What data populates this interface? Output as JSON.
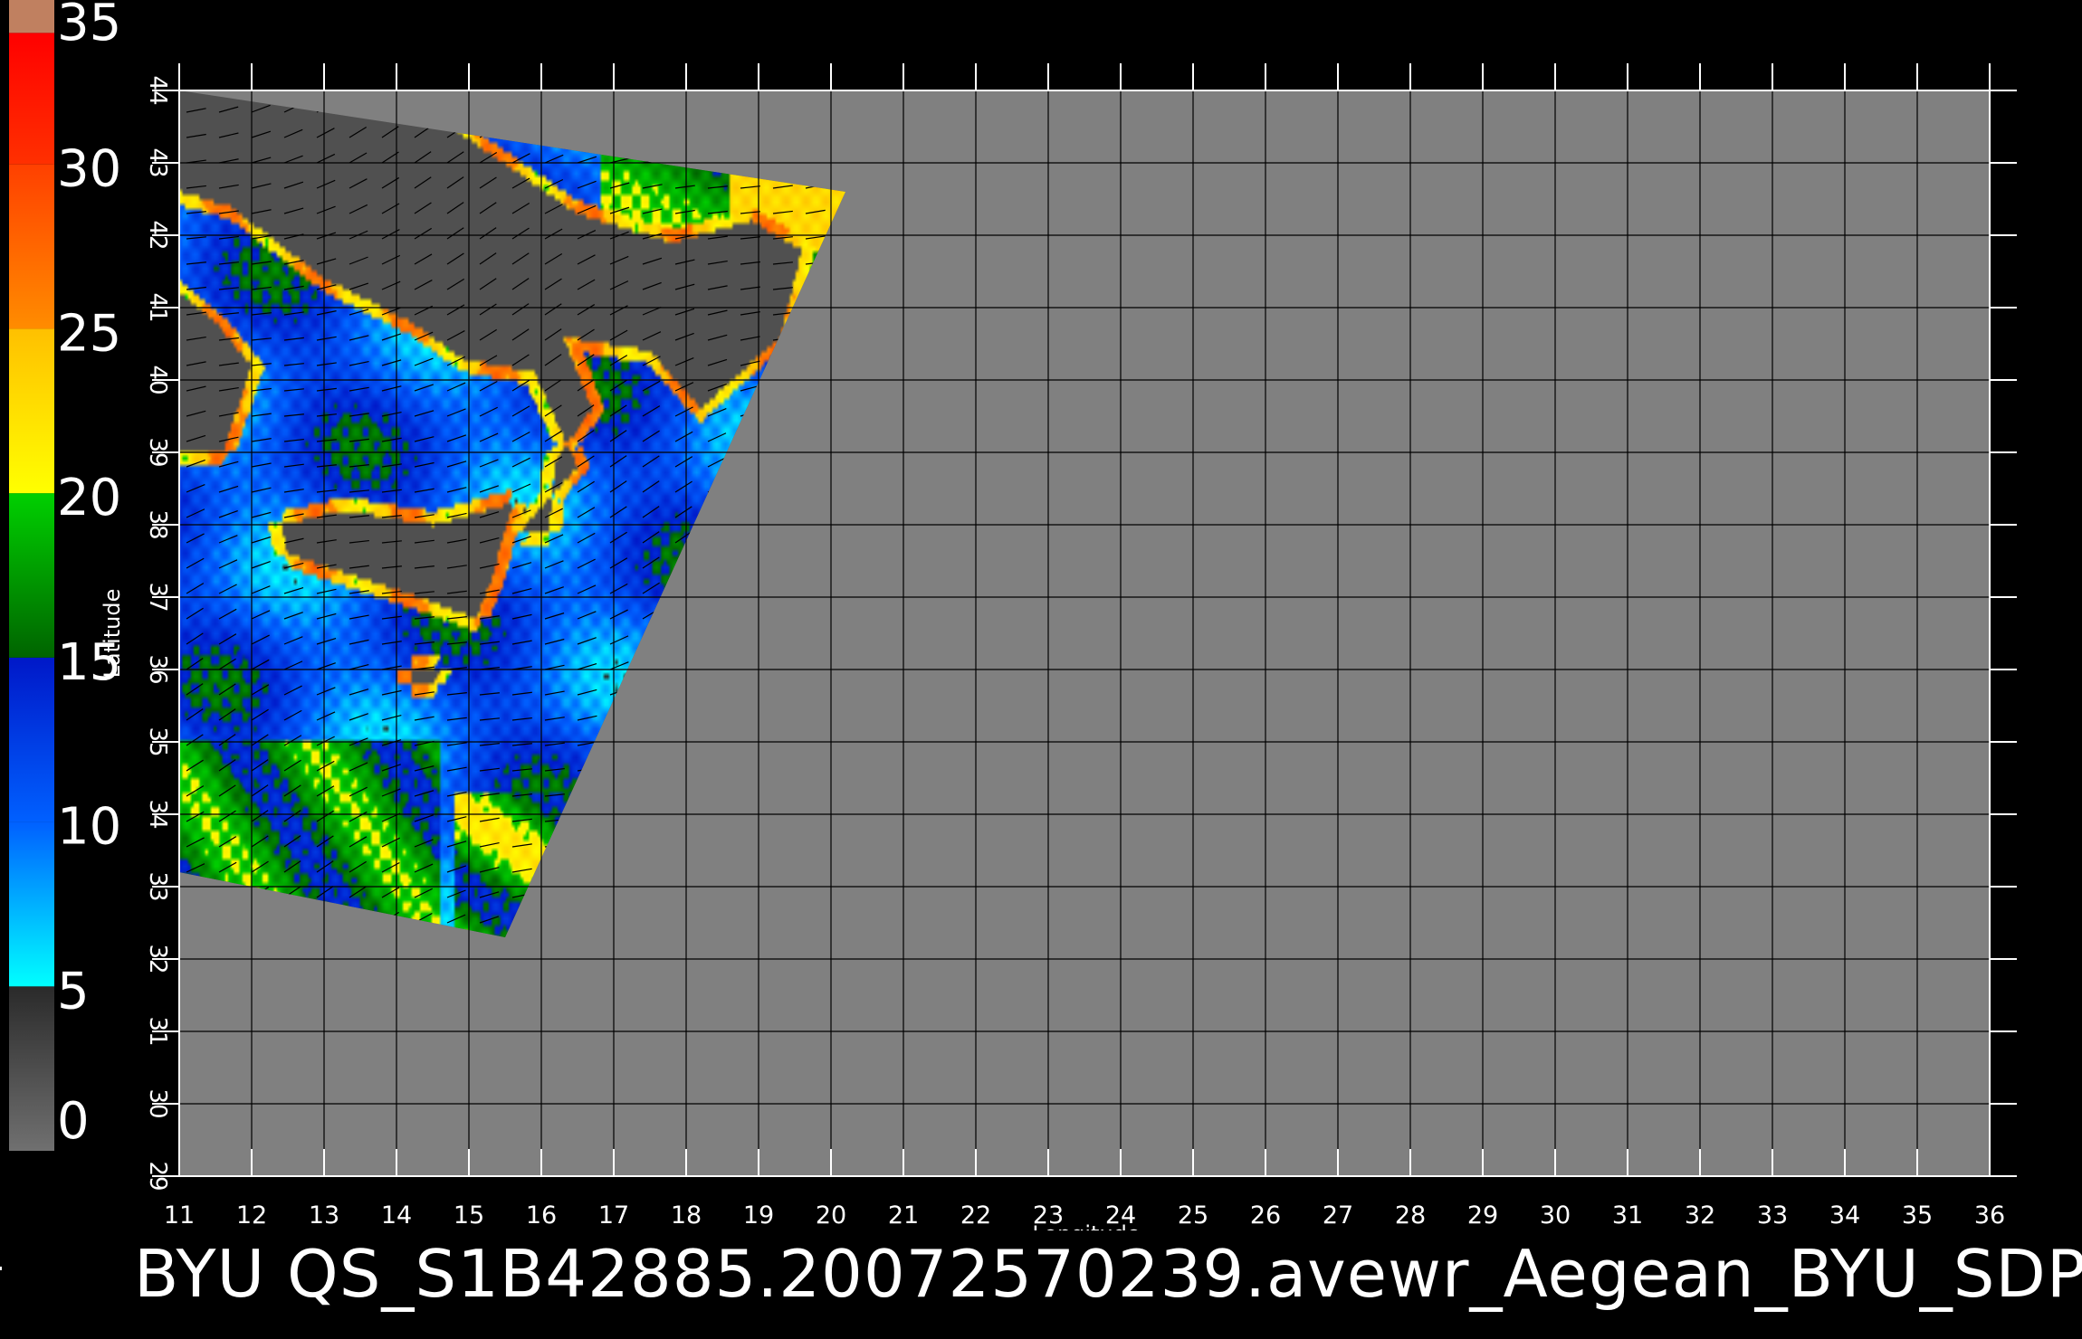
{
  "title": "BYU QS_S1B42885.20072570239.avewr_Aegean_BYU_SDP",
  "colorbar": {
    "labels": [
      "35",
      "30",
      "25",
      "20",
      "15",
      "10",
      "5",
      "0"
    ],
    "range": [
      0,
      35
    ],
    "segments": [
      {
        "from": 0,
        "to": 5,
        "colors": [
          "#707070",
          "#2a2a2a"
        ]
      },
      {
        "from": 5,
        "to": 10,
        "colors": [
          "#00ffff",
          "#0060ff"
        ]
      },
      {
        "from": 10,
        "to": 15,
        "colors": [
          "#0060ff",
          "#0018c8"
        ]
      },
      {
        "from": 15,
        "to": 20,
        "colors": [
          "#006400",
          "#00d000"
        ]
      },
      {
        "from": 20,
        "to": 25,
        "colors": [
          "#ffff00",
          "#ffc000"
        ]
      },
      {
        "from": 25,
        "to": 30,
        "colors": [
          "#ff8c00",
          "#ff4000"
        ]
      },
      {
        "from": 30,
        "to": 34,
        "colors": [
          "#ff3000",
          "#ff0000"
        ]
      },
      {
        "from": 34,
        "to": 35,
        "colors": [
          "#c08060",
          "#c08060"
        ]
      }
    ]
  },
  "map": {
    "xlabel": "Longitude",
    "ylabel": "Latitude",
    "lon_range": [
      11,
      36
    ],
    "lat_range": [
      29,
      44
    ],
    "lon_ticks": [
      "11",
      "12",
      "13",
      "14",
      "15",
      "16",
      "17",
      "18",
      "19",
      "20",
      "21",
      "22",
      "23",
      "24",
      "25",
      "26",
      "27",
      "28",
      "29",
      "30",
      "31",
      "32",
      "33",
      "34",
      "35",
      "36"
    ],
    "lat_ticks": [
      "29",
      "30",
      "31",
      "32",
      "33",
      "34",
      "35",
      "36",
      "37",
      "38",
      "39",
      "40",
      "41",
      "42",
      "43",
      "44"
    ],
    "background_color": "#808080",
    "no_data_color": "#505050",
    "grid_color": "#000000",
    "swath_corners_lonlat": [
      [
        11,
        44
      ],
      [
        20.2,
        42.6
      ],
      [
        15.5,
        32.3
      ],
      [
        11,
        33.2
      ]
    ]
  }
}
